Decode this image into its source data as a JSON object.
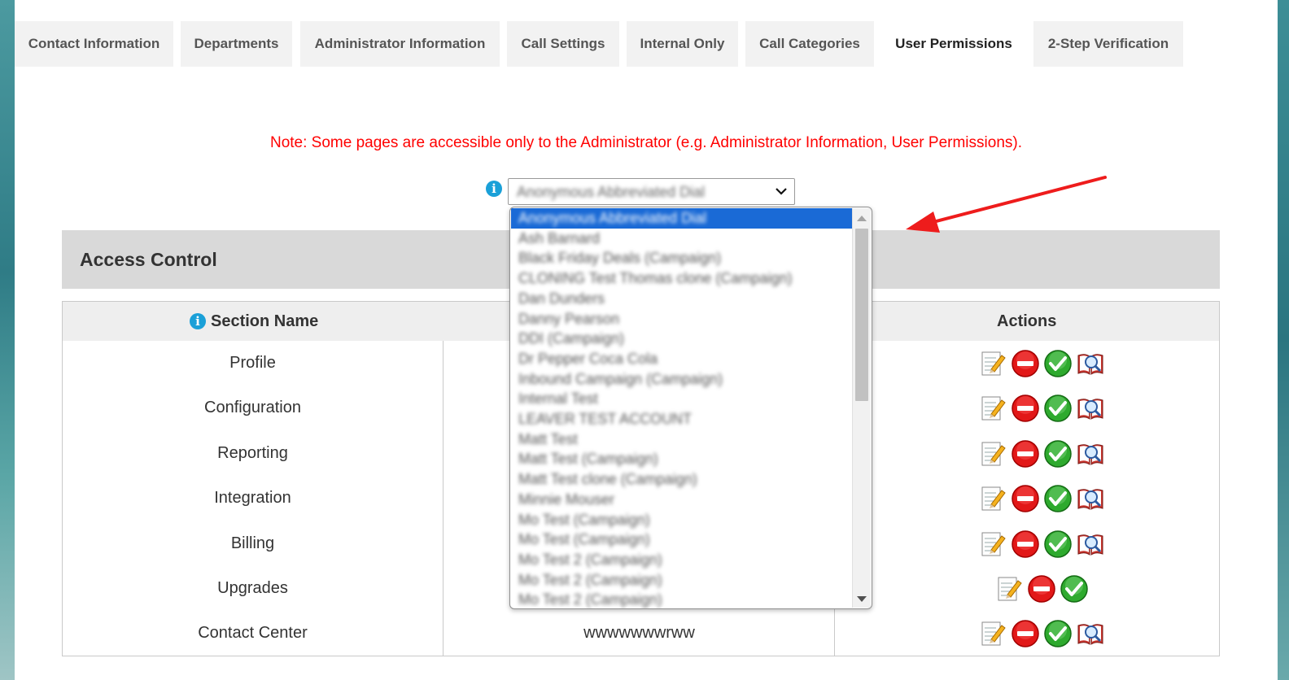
{
  "tabs": [
    {
      "label": "Contact Information"
    },
    {
      "label": "Departments"
    },
    {
      "label": "Administrator Information"
    },
    {
      "label": "Call Settings"
    },
    {
      "label": "Internal Only"
    },
    {
      "label": "Call Categories"
    },
    {
      "label": "User Permissions",
      "active": true
    },
    {
      "label": "2-Step Verification"
    }
  ],
  "note": "Note: Some pages are accessible only to the Administrator (e.g. Administrator Information, User Permissions).",
  "user_select": {
    "selected": "Anonymous Abbreviated Dial",
    "options": [
      "Anonymous Abbreviated Dial",
      "Ash Barnard",
      "Black Friday Deals (Campaign)",
      "CLONING Test Thomas clone (Campaign)",
      "Dan Dunders",
      "Danny Pearson",
      "DDI (Campaign)",
      "Dr Pepper Coca Cola",
      "Inbound Campaign (Campaign)",
      "Internal Test",
      "LEAVER TEST ACCOUNT",
      "Matt Test",
      "Matt Test (Campaign)",
      "Matt Test clone (Campaign)",
      "Minnie Mouser",
      "Mo Test (Campaign)",
      "Mo Test (Campaign)",
      "Mo Test 2 (Campaign)",
      "Mo Test 2 (Campaign)",
      "Mo Test 2 (Campaign)"
    ]
  },
  "access_control": {
    "title": "Access Control",
    "columns": {
      "section": "Section Name",
      "actions": "Actions"
    },
    "rows": [
      {
        "name": "Profile",
        "value": "",
        "actions": [
          "edit",
          "deny",
          "allow",
          "view"
        ]
      },
      {
        "name": "Configuration",
        "value": "",
        "actions": [
          "edit",
          "deny",
          "allow",
          "view"
        ]
      },
      {
        "name": "Reporting",
        "value": "",
        "actions": [
          "edit",
          "deny",
          "allow",
          "view"
        ]
      },
      {
        "name": "Integration",
        "value": "",
        "actions": [
          "edit",
          "deny",
          "allow",
          "view"
        ]
      },
      {
        "name": "Billing",
        "value": "",
        "actions": [
          "edit",
          "deny",
          "allow",
          "view"
        ]
      },
      {
        "name": "Upgrades",
        "value": "",
        "actions": [
          "edit",
          "deny",
          "allow"
        ]
      },
      {
        "name": "Contact Center",
        "value": "wwwwwwwrww",
        "actions": [
          "edit",
          "deny",
          "allow",
          "view"
        ]
      }
    ]
  },
  "colors": {
    "note": "#ff0000",
    "selected_option": "#1a6ad6",
    "info": "#1aa0d8",
    "arrow": "#ee1c1c"
  }
}
